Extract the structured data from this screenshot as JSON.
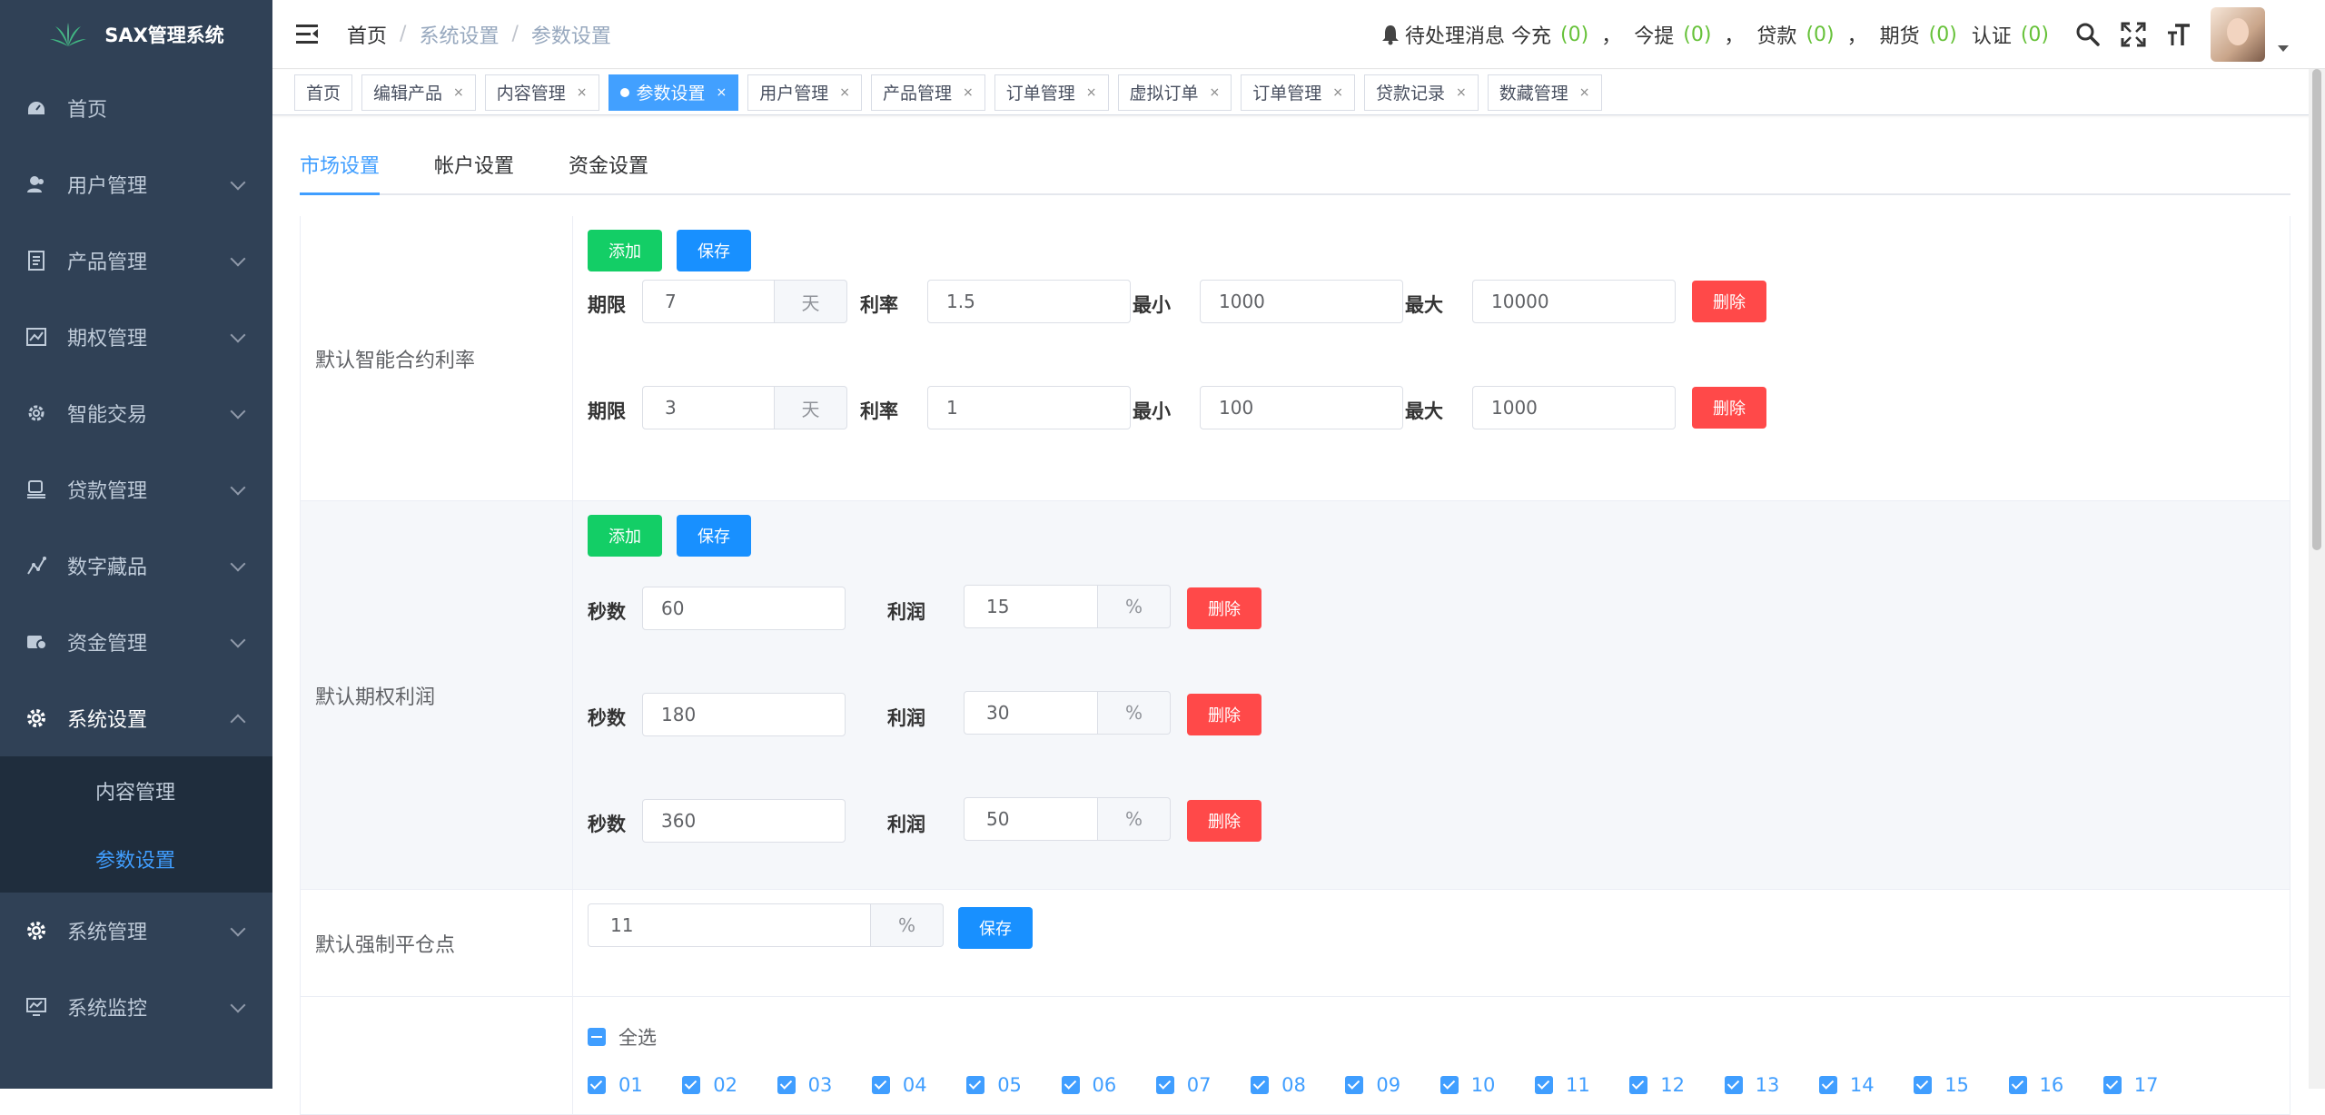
{
  "app": {
    "title": "SAX管理系统"
  },
  "sidebar": {
    "items": [
      {
        "label": "首页",
        "icon": "dashboard-icon"
      },
      {
        "label": "用户管理",
        "icon": "user-icon"
      },
      {
        "label": "产品管理",
        "icon": "document-icon"
      },
      {
        "label": "期权管理",
        "icon": "chart-icon"
      },
      {
        "label": "智能交易",
        "icon": "cog-icon"
      },
      {
        "label": "贷款管理",
        "icon": "money-icon"
      },
      {
        "label": "数字藏品",
        "icon": "trend-icon"
      },
      {
        "label": "资金管理",
        "icon": "wallet-icon"
      },
      {
        "label": "系统设置",
        "icon": "gear-icon"
      }
    ],
    "submenu": [
      {
        "label": "内容管理"
      },
      {
        "label": "参数设置"
      }
    ],
    "bottom_items": [
      {
        "label": "系统管理",
        "icon": "gear-icon"
      },
      {
        "label": "系统监控",
        "icon": "monitor-icon"
      }
    ]
  },
  "header": {
    "breadcrumb": {
      "home": "首页",
      "sep": "/",
      "level1": "系统设置",
      "level2": "参数设置"
    },
    "notify": {
      "label": "待处理消息 今充",
      "recharge_count": "(0)",
      "withdraw_label": "今提",
      "withdraw_count": "(0)",
      "loan_label": "贷款",
      "loan_count": "(0)",
      "futures_label": "期货",
      "futures_count": "(0)",
      "verify_label": "认证",
      "verify_count": "(0)",
      "comma": "，"
    }
  },
  "tags": [
    {
      "label": "首页",
      "closable": false,
      "active": false
    },
    {
      "label": "编辑产品",
      "closable": true,
      "active": false
    },
    {
      "label": "内容管理",
      "closable": true,
      "active": false
    },
    {
      "label": "参数设置",
      "closable": true,
      "active": true
    },
    {
      "label": "用户管理",
      "closable": true,
      "active": false
    },
    {
      "label": "产品管理",
      "closable": true,
      "active": false
    },
    {
      "label": "订单管理",
      "closable": true,
      "active": false
    },
    {
      "label": "虚拟订单",
      "closable": true,
      "active": false
    },
    {
      "label": "订单管理",
      "closable": true,
      "active": false
    },
    {
      "label": "贷款记录",
      "closable": true,
      "active": false
    },
    {
      "label": "数藏管理",
      "closable": true,
      "active": false
    }
  ],
  "tag_close": "×",
  "page_tabs": [
    {
      "label": "市场设置",
      "active": true
    },
    {
      "label": "帐户设置",
      "active": false
    },
    {
      "label": "资金设置",
      "active": false
    }
  ],
  "buttons": {
    "add": "添加",
    "save": "保存",
    "delete": "删除"
  },
  "smart_contract": {
    "label": "默认智能合约利率",
    "field_labels": {
      "term": "期限",
      "rate": "利率",
      "min": "最小",
      "max": "最大",
      "unit": "天"
    },
    "rows": [
      {
        "term": "7",
        "rate": "1.5",
        "min": "1000",
        "max": "10000"
      },
      {
        "term": "3",
        "rate": "1",
        "min": "100",
        "max": "1000"
      }
    ]
  },
  "option_profit": {
    "label": "默认期权利润",
    "field_labels": {
      "seconds": "秒数",
      "profit": "利润",
      "unit": "%"
    },
    "rows": [
      {
        "seconds": "60",
        "profit": "15"
      },
      {
        "seconds": "180",
        "profit": "30"
      },
      {
        "seconds": "360",
        "profit": "50"
      }
    ]
  },
  "liquidation": {
    "label": "默认强制平仓点",
    "value": "11",
    "unit": "%"
  },
  "checkboxes": {
    "select_all": "全选",
    "items": [
      "01",
      "02",
      "03",
      "04",
      "05",
      "06",
      "07",
      "08",
      "09",
      "10",
      "11",
      "12",
      "13",
      "14",
      "15",
      "16",
      "17"
    ]
  }
}
